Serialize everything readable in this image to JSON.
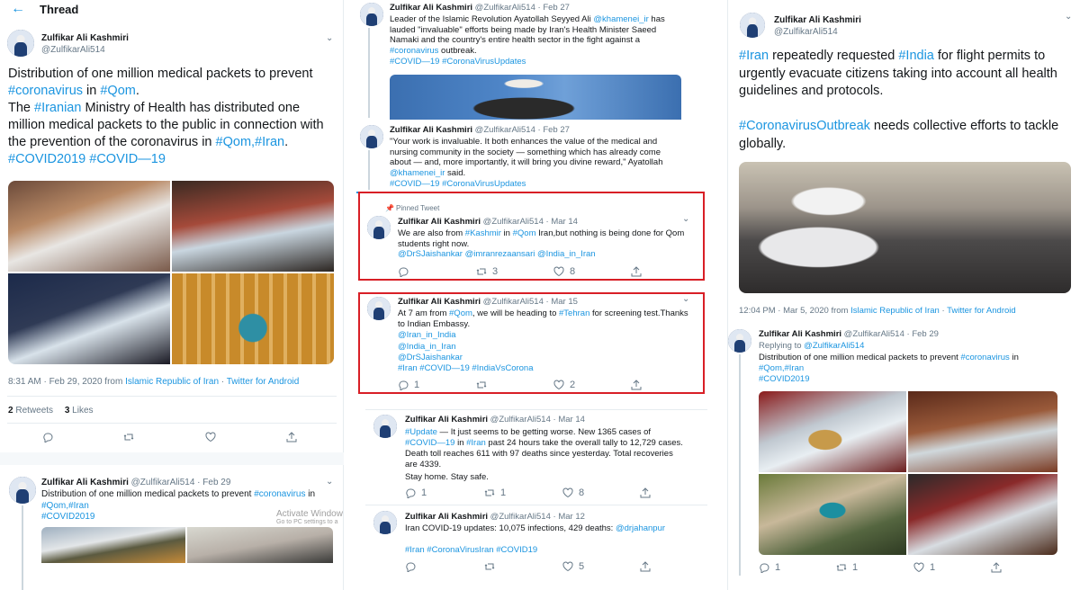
{
  "header": {
    "title": "Thread",
    "back_icon": "arrow-left-icon"
  },
  "author": {
    "name": "Zulfikar Ali Kashmiri",
    "handle": "@ZulfikarAli514"
  },
  "left": {
    "main": {
      "line1": "Distribution of one million medical packets to prevent ",
      "tag_coronavirus": "#coronavirus",
      "in": " in ",
      "tag_qom": "#Qom",
      "dot": ".",
      "line2a": " The ",
      "tag_iranian": "#Iranian",
      "line2b": " Ministry of Health has distributed one million medical packets to the public in connection with the prevention of the coronavirus in ",
      "tag_qom_iran": "#Qom,#Iran",
      "dot2": ".",
      "tag_covid": "#COVID2019 #COVID—19"
    },
    "meta": {
      "time": "8:31 AM · Feb 29, 2020 from ",
      "place": "Islamic Republic of Iran",
      "sep": " · ",
      "app": "Twitter for Android"
    },
    "stats": {
      "retweets_n": "2",
      "retweets": "Retweets",
      "likes_n": "3",
      "likes": "Likes"
    },
    "reply": {
      "date": "· Feb 29",
      "text": "Distribution of one million medical packets to prevent ",
      "tag": "#coronavirus",
      "in": " in",
      "tags2": "#Qom,#Iran",
      "tags3": "#COVID2019",
      "watermark1": "Activate Window",
      "watermark2": "Go to PC settings to a"
    }
  },
  "middle": {
    "t1": {
      "date": "· Feb 27",
      "text_a": "Leader of the Islamic Revolution Ayatollah Seyyed Ali ",
      "mention": "@khamenei_ir",
      "text_b": " has lauded \"invaluable\" efforts being made by Iran's Health Minister Saeed Namaki and the country's entire health sector in the fight against a ",
      "tag": "#coronavirus",
      "text_c": " outbreak.",
      "tags": "#COVID—19 #CoronaVirusUpdates"
    },
    "t2": {
      "date": "· Feb 27",
      "text_a": "\"Your work is invaluable. It both enhances the value of the medical and nursing community in the society — something which has already come about — and, more importantly, it will bring you divine reward,\" Ayatollah ",
      "mention": "@khamenei_ir",
      "text_b": " said.",
      "tags": "#COVID—19 #CoronaVirusUpdates"
    },
    "t3": {
      "pinned": "Pinned Tweet",
      "date": "· Mar 14",
      "text_a": "We are also from ",
      "tag1": "#Kashmir",
      "text_b": " in ",
      "tag2": "#Qom",
      "text_c": " Iran,but nothing is being done for Qom students right now.",
      "mentions": "@DrSJaishankar @imranrezaansari @India_in_Iran",
      "retweets": "3",
      "likes": "8"
    },
    "t4": {
      "date": "· Mar 15",
      "text_a": "At 7 am from ",
      "tag1": "#Qom",
      "text_b": ", we will be heading to ",
      "tag2": "#Tehran",
      "text_c": " for screening test.Thanks to Indian Embassy.",
      "m1": "@Iran_in_India",
      "m2": "@India_in_Iran",
      "m3": "@DrSJaishankar",
      "tags": "#Iran #COVID—19 #IndiaVsCorona",
      "replies": "1",
      "likes": "2"
    },
    "t5": {
      "date": "· Mar 14",
      "tag1": "#Update",
      "text_a": " — It just seems to be getting worse. New 1365 cases of ",
      "tag2": "#COVID—19",
      "text_b": " in ",
      "tag3": "#Iran",
      "text_c": " past 24 hours take the overall tally to 12,729 cases. Death toll reaches 611 with 97 deaths since yesterday. Total recoveries are 4339.",
      "text_d": "Stay home. Stay safe.",
      "replies": "1",
      "retweets": "1",
      "likes": "8"
    },
    "t6": {
      "date": "· Mar 12",
      "text_a": "Iran COVID-19 updates: 10,075 infections, 429 deaths: ",
      "mention": "@drjahanpur",
      "tags": "#Iran #CoronaVirusIran #COVID19",
      "likes": "5"
    }
  },
  "right": {
    "main": {
      "tag_iran": "#Iran",
      "text_a": " repeatedly requested ",
      "tag_india": "#India",
      "text_b": " for flight permits to urgently evacuate citizens taking into account all health guidelines and protocols.",
      "tag_outbreak": "#CoronavirusOutbreak",
      "text_c": " needs collective efforts to tackle globally."
    },
    "meta": {
      "time": "12:04 PM · Mar 5, 2020 from ",
      "place": "Islamic Republic of Iran",
      "sep": " · ",
      "app": "Twitter for Android"
    },
    "reply": {
      "date": "· Feb 29",
      "replying": "Replying to ",
      "replying_handle": "@ZulfikarAli514",
      "text": "Distribution of one million medical packets to prevent ",
      "tag": "#coronavirus",
      "in": " in",
      "tags2": "#Qom,#Iran",
      "tags3": "#COVID2019",
      "replies": "1",
      "retweets": "1",
      "likes": "1"
    }
  },
  "colors": {
    "link": "#1b95e0",
    "highlight": "#d81f26",
    "muted": "#657786"
  }
}
